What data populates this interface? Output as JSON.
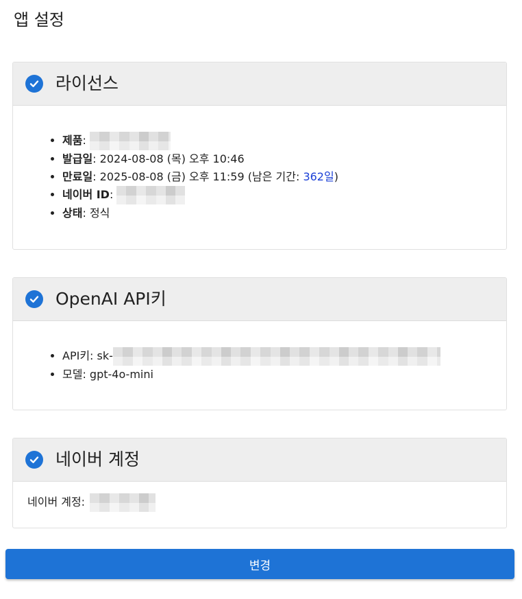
{
  "page": {
    "title": "앱 설정"
  },
  "license": {
    "title": "라이선스",
    "items": [
      {
        "label": "제품",
        "value": ""
      },
      {
        "label": "발급일",
        "value": "2024-08-08 (목) 오후 10:46"
      },
      {
        "label": "만료일",
        "value": "2025-08-08 (금) 오후 11:59 (남은 기간: ",
        "days_number": "362",
        "days_unit": "일",
        "suffix": ")"
      },
      {
        "label": "네이버 ID",
        "value": ""
      },
      {
        "label": "상태",
        "value": "정식"
      }
    ]
  },
  "openai": {
    "title": "OpenAI API키",
    "api_key_label": "API키: sk-",
    "model_label": "모델: gpt-4o-mini"
  },
  "naver": {
    "title": "네이버 계정",
    "account_label": "네이버 계정:"
  },
  "actions": {
    "change_label": "변경"
  },
  "colors": {
    "accent": "#1e73d6",
    "link": "#1a3fd6",
    "header_bg": "#eeeeee"
  },
  "icons": {
    "section_status": "check-circle-icon"
  }
}
